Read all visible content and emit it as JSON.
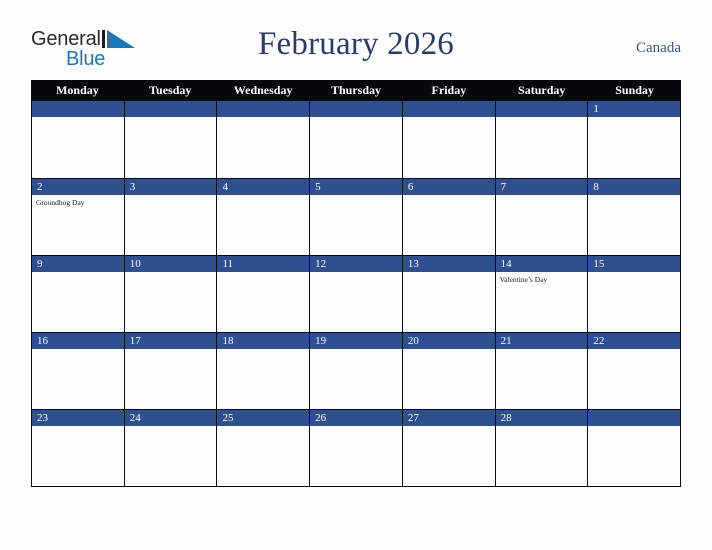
{
  "brand": {
    "logo_text_top": "General",
    "logo_text_bottom": "Blue",
    "logo_mark": "triangle-icon",
    "accent_blue": "#1878be"
  },
  "header": {
    "title": "February 2026",
    "country": "Canada"
  },
  "colors": {
    "weekday_header_bg": "#08080c",
    "day_band_blue": "#2e5090",
    "title_navy": "#2b3d66",
    "page_bg": "#fdfdfd",
    "grid_line": "#0b0b0f"
  },
  "calendar": {
    "month": "February",
    "year": "2026",
    "weekday_labels": [
      "Monday",
      "Tuesday",
      "Wednesday",
      "Thursday",
      "Friday",
      "Saturday",
      "Sunday"
    ],
    "weeks": [
      [
        {
          "day": "",
          "events": []
        },
        {
          "day": "",
          "events": []
        },
        {
          "day": "",
          "events": []
        },
        {
          "day": "",
          "events": []
        },
        {
          "day": "",
          "events": []
        },
        {
          "day": "",
          "events": []
        },
        {
          "day": "1",
          "events": []
        }
      ],
      [
        {
          "day": "2",
          "events": [
            "Groundhog Day"
          ]
        },
        {
          "day": "3",
          "events": []
        },
        {
          "day": "4",
          "events": []
        },
        {
          "day": "5",
          "events": []
        },
        {
          "day": "6",
          "events": []
        },
        {
          "day": "7",
          "events": []
        },
        {
          "day": "8",
          "events": []
        }
      ],
      [
        {
          "day": "9",
          "events": []
        },
        {
          "day": "10",
          "events": []
        },
        {
          "day": "11",
          "events": []
        },
        {
          "day": "12",
          "events": []
        },
        {
          "day": "13",
          "events": []
        },
        {
          "day": "14",
          "events": [
            "Valentine’s Day"
          ]
        },
        {
          "day": "15",
          "events": []
        }
      ],
      [
        {
          "day": "16",
          "events": []
        },
        {
          "day": "17",
          "events": []
        },
        {
          "day": "18",
          "events": []
        },
        {
          "day": "19",
          "events": []
        },
        {
          "day": "20",
          "events": []
        },
        {
          "day": "21",
          "events": []
        },
        {
          "day": "22",
          "events": []
        }
      ],
      [
        {
          "day": "23",
          "events": []
        },
        {
          "day": "24",
          "events": []
        },
        {
          "day": "25",
          "events": []
        },
        {
          "day": "26",
          "events": []
        },
        {
          "day": "27",
          "events": []
        },
        {
          "day": "28",
          "events": []
        },
        {
          "day": "",
          "events": []
        }
      ]
    ]
  }
}
